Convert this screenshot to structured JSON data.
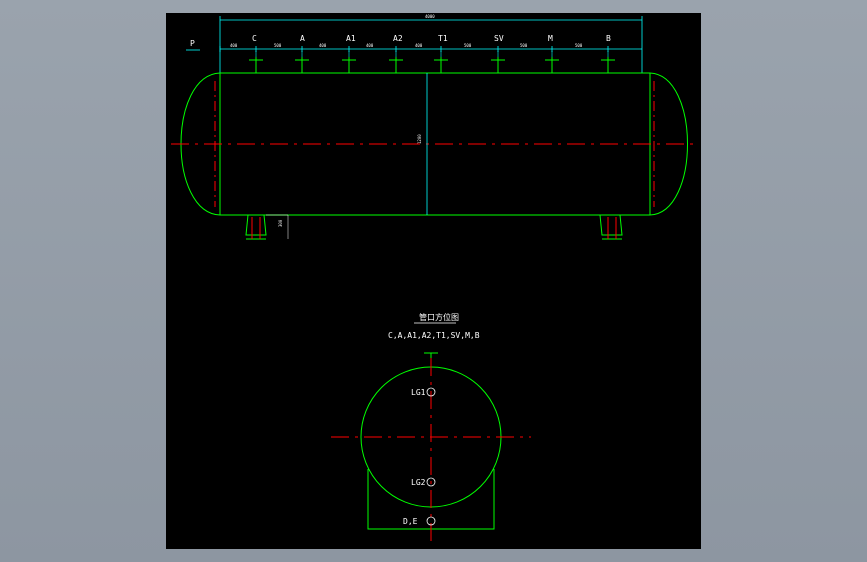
{
  "colors": {
    "background": "#000000",
    "outline": "#00ff00",
    "dimension": "#00ffff",
    "centerline": "#ff0000",
    "text": "#ffffff"
  },
  "side_view": {
    "overall_dim_label": "4000",
    "p_label": "P",
    "nozzles": [
      {
        "label": "C",
        "spacing": "400"
      },
      {
        "label": "A",
        "spacing": "500"
      },
      {
        "label": "A1",
        "spacing": "400"
      },
      {
        "label": "A2",
        "spacing": "400"
      },
      {
        "label": "T1",
        "spacing": "400"
      },
      {
        "label": "SV",
        "spacing": "500"
      },
      {
        "label": "M",
        "spacing": "500"
      },
      {
        "label": "B",
        "spacing": "500"
      }
    ],
    "diameter_label": "1200",
    "saddle_dim_label": "300"
  },
  "end_view": {
    "title": "管口方位图",
    "nozzle_list": "C,A,A1,A2,T1,SV,M,B",
    "labels": [
      "LG1",
      "LG2",
      "D,E"
    ]
  }
}
